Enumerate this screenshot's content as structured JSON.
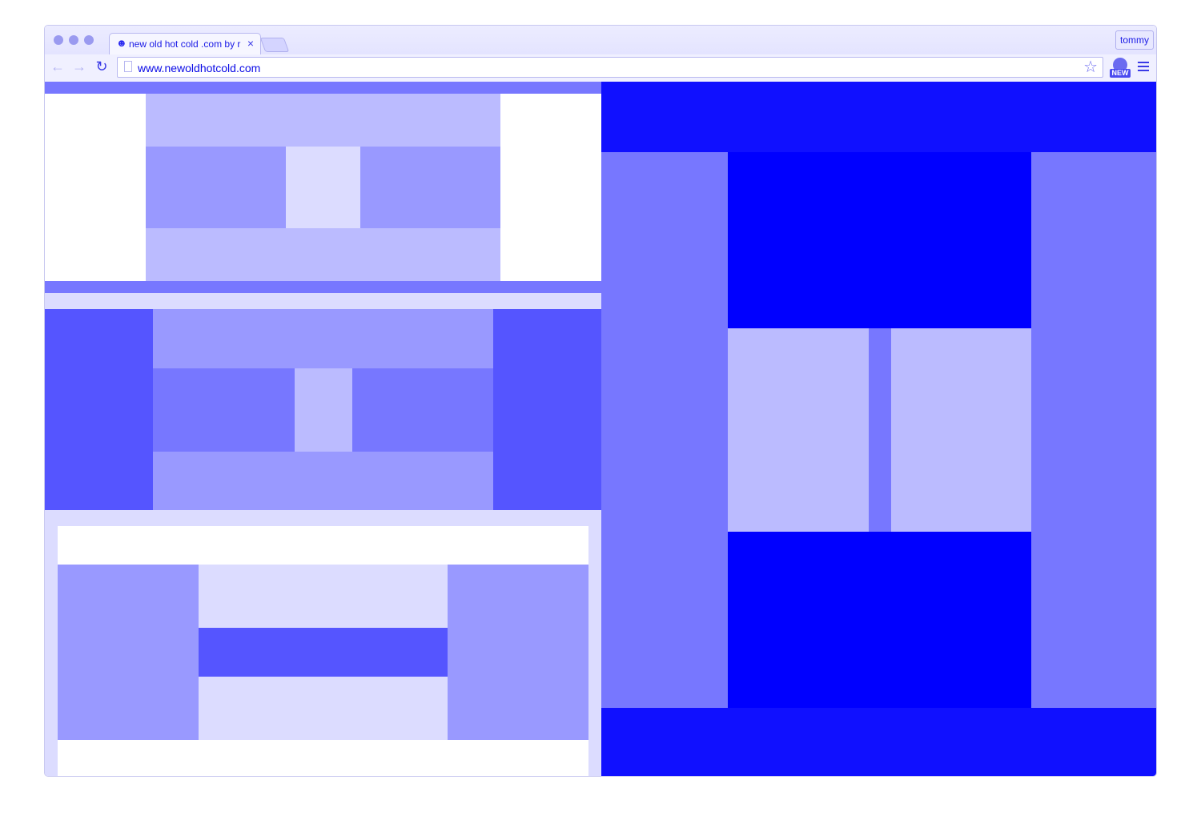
{
  "browser": {
    "tab_title": "new old hot cold .com by r",
    "tab_close": "×",
    "profile_name": "tommy",
    "url": "www.newoldhotcold.com",
    "extension_badge": "NEW"
  },
  "colors": {
    "accent": "#0000ff",
    "blue_strong": "#1010ff",
    "blue_mid": "#5555ff",
    "blue_soft": "#7777ff",
    "blue_light": "#9999ff",
    "blue_pale": "#bbbbff",
    "blue_faint": "#dcdcff"
  },
  "icons": {
    "back": "arrow-left-icon",
    "forward": "arrow-right-icon",
    "reload": "reload-icon",
    "bookmark": "star-icon",
    "menu": "hamburger-menu-icon"
  }
}
